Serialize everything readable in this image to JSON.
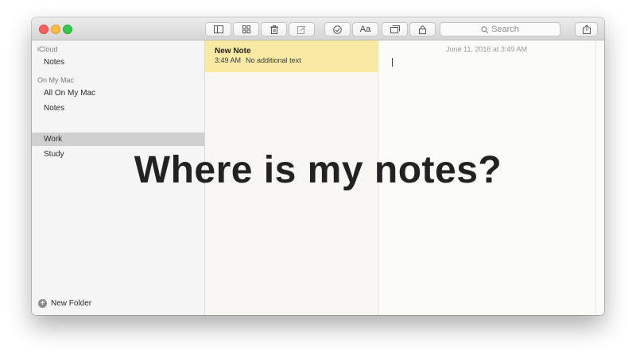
{
  "window": {
    "traffic_lights": [
      "close",
      "minimize",
      "zoom"
    ],
    "colors": {
      "close": "#fc605c",
      "minimize": "#fdbc40",
      "zoom": "#34c84a"
    }
  },
  "toolbar": {
    "buttons": [
      {
        "icon": "sidebar-toggle-icon"
      },
      {
        "icon": "gallery-grid-icon"
      },
      {
        "icon": "trash-icon"
      },
      {
        "icon": "compose-icon"
      },
      {
        "icon": "checklist-icon"
      },
      {
        "icon": "format-text-icon",
        "label": "Aa"
      },
      {
        "icon": "attachments-icon"
      },
      {
        "icon": "lock-icon"
      },
      {
        "icon": "share-icon"
      }
    ],
    "search_placeholder": "Search"
  },
  "sidebar": {
    "sections": [
      {
        "header": "iCloud",
        "items": [
          "Notes"
        ]
      },
      {
        "header": "On My Mac",
        "items": [
          "All On My Mac",
          "Notes",
          "Work",
          "Study"
        ]
      }
    ],
    "selected": "Work",
    "new_folder_label": "New Folder"
  },
  "note_list": {
    "notes": [
      {
        "title": "New Note",
        "time": "3:49 AM",
        "preview": "No additional text",
        "highlight_color": "#f8e9a3"
      }
    ]
  },
  "editor": {
    "timestamp": "June 11, 2016 at 3:49 AM"
  },
  "overlay": {
    "caption": "Where is my notes?"
  }
}
